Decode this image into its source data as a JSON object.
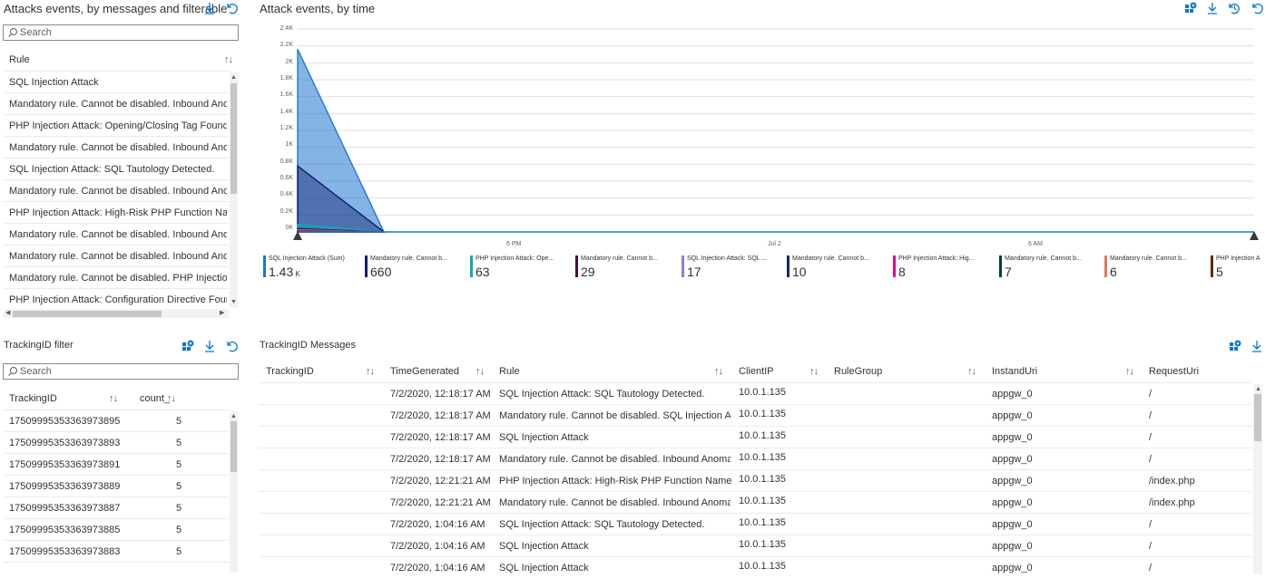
{
  "attacks_panel": {
    "title": "Attacks events, by messages and filterable",
    "search_placeholder": "Search",
    "column_header": "Rule",
    "sort_glyph": "↑↓",
    "rows": [
      "SQL Injection Attack",
      "Mandatory rule. Cannot be disabled. Inbound Anomaly",
      "PHP Injection Attack: Opening/Closing Tag Found",
      "Mandatory rule. Cannot be disabled. Inbound Anomaly",
      "SQL Injection Attack: SQL Tautology Detected.",
      "Mandatory rule. Cannot be disabled. Inbound Anomaly",
      "PHP Injection Attack: High-Risk PHP Function Name Fou",
      "Mandatory rule. Cannot be disabled. Inbound Anomaly",
      "Mandatory rule. Cannot be disabled. Inbound Anomaly",
      "Mandatory rule. Cannot be disabled. PHP Injection Attac",
      "PHP Injection Attack: Configuration Directive Found"
    ]
  },
  "chart_panel": {
    "title": "Attack events, by time"
  },
  "chart_data": {
    "type": "area",
    "title": "Attack events, by time",
    "y_ticks": [
      "0K",
      "0.2K",
      "0.4K",
      "0.6K",
      "0.8K",
      "1K",
      "1.2K",
      "1.4K",
      "1.6K",
      "1.8K",
      "2K",
      "2.2K",
      "2.4K"
    ],
    "ylim": [
      0,
      2400
    ],
    "x_ticks": [
      "6 PM",
      "Jul 2",
      "6 AM"
    ],
    "grid": true,
    "series": [
      {
        "name": "SQL Injection Attack (Sum)",
        "display": "1.43",
        "unit": "K",
        "color": "#1f77d0",
        "peak": 2160
      },
      {
        "name": "Mandatory rule. Cannot b...",
        "display": "660",
        "unit": "",
        "color": "#0f1e6e",
        "peak": 780
      },
      {
        "name": "PHP Injection Attack: Ope...",
        "display": "63",
        "unit": "",
        "color": "#13a8b5",
        "peak": 90
      },
      {
        "name": "Mandatory rule. Cannot b...",
        "display": "29",
        "unit": "",
        "color": "#4b0f3c",
        "peak": 40
      },
      {
        "name": "SQL Injection Attack: SQL ...",
        "display": "17",
        "unit": "",
        "color": "#8b7fe0",
        "peak": 25
      },
      {
        "name": "Mandatory rule. Cannot b...",
        "display": "10",
        "unit": "",
        "color": "#102a5c",
        "peak": 15
      },
      {
        "name": "PHP Injection Attack: Hig...",
        "display": "8",
        "unit": "",
        "color": "#e3008c",
        "peak": 12
      },
      {
        "name": "Mandatory rule. Cannot b...",
        "display": "7",
        "unit": "",
        "color": "#0b3d2e",
        "peak": 10
      },
      {
        "name": "Mandatory rule. Cannot b...",
        "display": "6",
        "unit": "",
        "color": "#e8745e",
        "peak": 8
      },
      {
        "name": "PHP Injection A",
        "display": "5",
        "unit": "",
        "color": "#5a2d0c",
        "peak": 6
      }
    ]
  },
  "tracking_filter": {
    "title": "TrackingID filter",
    "search_placeholder": "Search",
    "headers": [
      "TrackingID",
      "count_"
    ],
    "sort_glyph": "↑↓",
    "rows": [
      [
        "17509995353363973895",
        "5"
      ],
      [
        "17509995353363973893",
        "5"
      ],
      [
        "17509995353363973891",
        "5"
      ],
      [
        "17509995353363973889",
        "5"
      ],
      [
        "17509995353363973887",
        "5"
      ],
      [
        "17509995353363973885",
        "5"
      ],
      [
        "17509995353363973883",
        "5"
      ]
    ]
  },
  "messages_panel": {
    "title": "TrackingID Messages",
    "headers": [
      "TrackingID",
      "TimeGenerated",
      "Rule",
      "ClientIP",
      "RuleGroup",
      "InstandUri",
      "RequestUri"
    ],
    "sort_glyph": "↑↓",
    "rows": [
      [
        "",
        "7/2/2020, 12:18:17 AM",
        "SQL Injection Attack: SQL Tautology Detected.",
        "10.0.1.135",
        "",
        "appgw_0",
        "/"
      ],
      [
        "",
        "7/2/2020, 12:18:17 AM",
        "Mandatory rule. Cannot be disabled. SQL Injection Attack",
        "10.0.1.135",
        "",
        "appgw_0",
        "/"
      ],
      [
        "",
        "7/2/2020, 12:18:17 AM",
        "SQL Injection Attack",
        "10.0.1.135",
        "",
        "appgw_0",
        "/"
      ],
      [
        "",
        "7/2/2020, 12:18:17 AM",
        "Mandatory rule. Cannot be disabled. Inbound Anomaly S...",
        "10.0.1.135",
        "",
        "appgw_0",
        "/"
      ],
      [
        "",
        "7/2/2020, 12:21:21 AM",
        "PHP Injection Attack: High-Risk PHP Function Name Found",
        "10.0.1.135",
        "",
        "appgw_0",
        "/index.php"
      ],
      [
        "",
        "7/2/2020, 12:21:21 AM",
        "Mandatory rule. Cannot be disabled. Inbound Anomaly S...",
        "10.0.1.135",
        "",
        "appgw_0",
        "/index.php"
      ],
      [
        "",
        "7/2/2020, 1:04:16 AM",
        "SQL Injection Attack: SQL Tautology Detected.",
        "10.0.1.135",
        "",
        "appgw_0",
        "/"
      ],
      [
        "",
        "7/2/2020, 1:04:16 AM",
        "SQL Injection Attack",
        "10.0.1.135",
        "",
        "appgw_0",
        "/"
      ],
      [
        "",
        "7/2/2020, 1:04:16 AM",
        "SQL Injection Attack",
        "10.0.1.135",
        "",
        "appgw_0",
        "/"
      ]
    ]
  },
  "colors": {
    "accent": "#0078d4",
    "row_border": "#edebe9"
  }
}
